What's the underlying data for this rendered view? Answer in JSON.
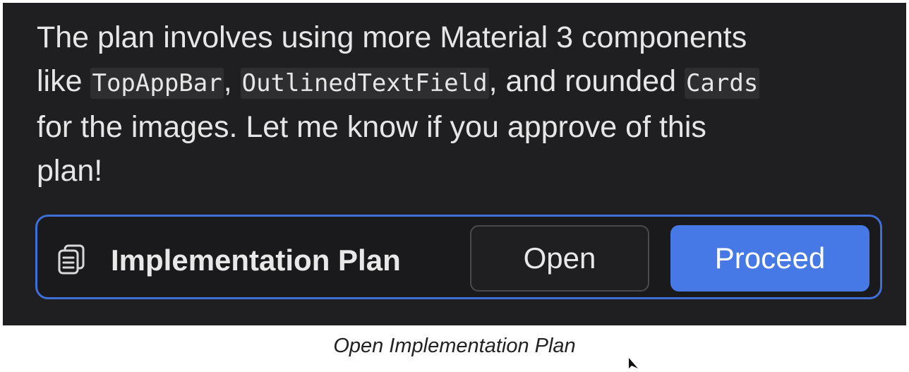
{
  "message": {
    "line1": "The plan involves using more Material 3 components",
    "line2_prefix": "like ",
    "code1": "TopAppBar",
    "sep1": ", ",
    "code2": "OutlinedTextField",
    "sep2": ", and rounded ",
    "code3": "Cards",
    "line3": "for the images. Let me know if you approve of this",
    "line4": "plan!"
  },
  "artifact": {
    "icon": "document-stack-icon",
    "title": "Implementation Plan",
    "open_label": "Open",
    "proceed_label": "Proceed"
  },
  "caption": "Open Implementation Plan",
  "colors": {
    "panel_bg": "#1f1f21",
    "accent": "#4679e6",
    "border_accent": "#3f6fd6"
  }
}
